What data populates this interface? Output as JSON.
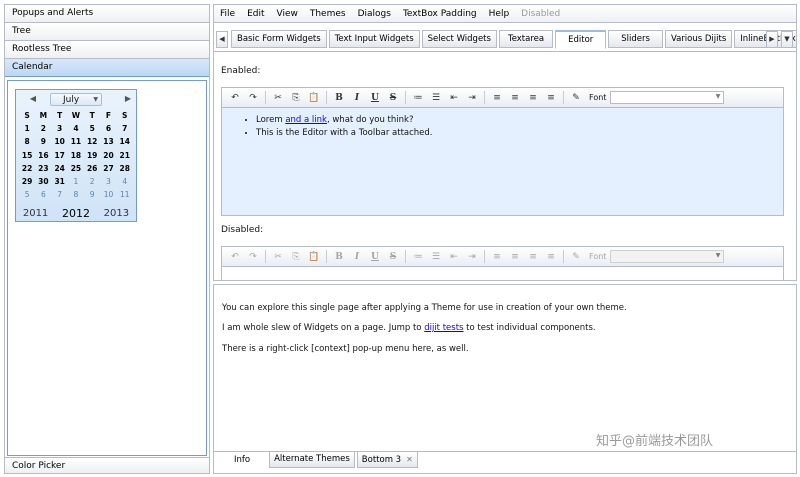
{
  "accordion": {
    "titles": [
      "Popups and Alerts",
      "Tree",
      "Rootless Tree",
      "Calendar"
    ],
    "bottom_title": "Color Picker"
  },
  "calendar": {
    "month": "July",
    "day_headers": [
      "S",
      "M",
      "T",
      "W",
      "T",
      "F",
      "S"
    ],
    "weeks": [
      [
        "1",
        "2",
        "3",
        "4",
        "5",
        "6",
        "7"
      ],
      [
        "8",
        "9",
        "10",
        "11",
        "12",
        "13",
        "14"
      ],
      [
        "15",
        "16",
        "17",
        "18",
        "19",
        "20",
        "21"
      ],
      [
        "22",
        "23",
        "24",
        "25",
        "26",
        "27",
        "28"
      ],
      [
        "29",
        "30",
        "31",
        "1",
        "2",
        "3",
        "4"
      ],
      [
        "5",
        "6",
        "7",
        "8",
        "9",
        "10",
        "11"
      ]
    ],
    "years": [
      "2011",
      "2012",
      "2013"
    ]
  },
  "menubar": {
    "items": [
      "File",
      "Edit",
      "View",
      "Themes",
      "Dialogs",
      "TextBox Padding",
      "Help"
    ],
    "disabled_item": "Disabled"
  },
  "tabs": [
    "Basic Form Widgets",
    "Text Input Widgets",
    "Select Widgets",
    "Textarea",
    "Editor",
    "Sliders",
    "Various Dijits",
    "InlineEditBox"
  ],
  "tab_scroll": {
    "left": "◀",
    "right": "▶",
    "menu": "▼"
  },
  "editor": {
    "enabled_label": "Enabled:",
    "disabled_label": "Disabled:",
    "font_label": "Font",
    "bullet1_before": "Lorem ",
    "bullet1_link": "and a link",
    "bullet1_after": ", what do you think?",
    "bullet2": "This is the Editor with a Toolbar attached.",
    "toolbar_icons": {
      "undo": "↶",
      "redo": "↷",
      "cut": "✂",
      "copy": "⎘",
      "paste": "📋",
      "bold": "B",
      "italic": "I",
      "underline": "U",
      "strike": "S",
      "ol": "≔",
      "ul": "☰",
      "outdent": "⇤",
      "indent": "⇥",
      "align_left": "≡",
      "align_center": "≡",
      "align_right": "≡",
      "justify": "≡",
      "highlight": "✎"
    }
  },
  "info": {
    "line1": "You can explore this single page after applying a Theme for use in creation of your own theme.",
    "line2_before": "I am whole slew of Widgets on a page. Jump to ",
    "line2_link": "dijit tests",
    "line2_after": " to test individual components.",
    "line3": "There is a right-click [context] pop-up menu here, as well."
  },
  "bottom_tabs": [
    "Info",
    "Alternate Themes",
    "Bottom 3"
  ],
  "bottom_tab_close": "✕",
  "watermark": "知乎@前端技术团队",
  "colors": {
    "border": "#b5bcc7",
    "selected_blue": "#769dc0",
    "editor_bg": "#e4efff",
    "link": "#1a00d8"
  }
}
